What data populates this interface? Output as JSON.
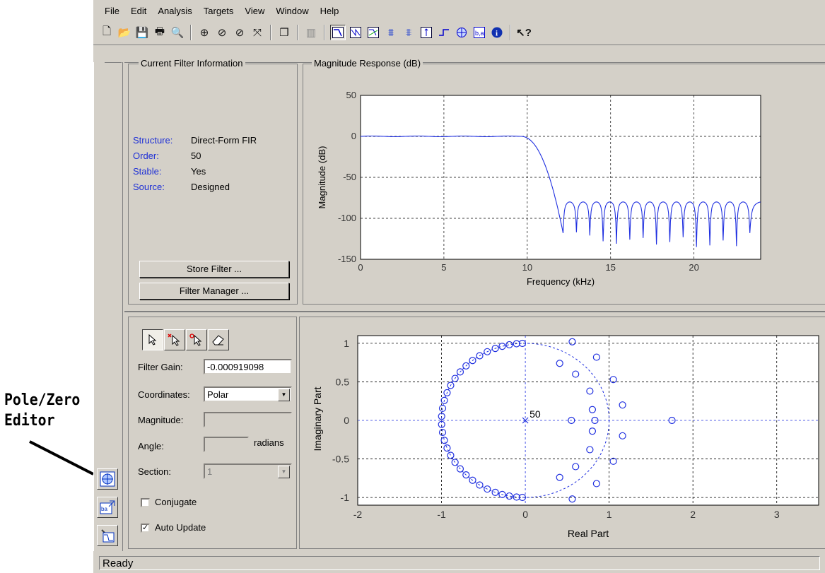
{
  "menu": [
    "File",
    "Edit",
    "Analysis",
    "Targets",
    "View",
    "Window",
    "Help"
  ],
  "toolbar_icons": [
    "new-icon",
    "open-icon",
    "save-icon",
    "print-icon",
    "print-preview-icon",
    "zoom-in-icon",
    "zoom-x-icon",
    "zoom-y-icon",
    "full-view-icon",
    "new-figure-icon",
    "data-tips-icon",
    "magnitude-response-icon",
    "phase-response-icon",
    "magnitude-phase-icon",
    "group-delay-icon",
    "phase-delay-icon",
    "impulse-response-icon",
    "step-response-icon",
    "pole-zero-plot-icon",
    "filter-coefficients-icon",
    "filter-information-icon",
    "whats-this-icon"
  ],
  "info_panel": {
    "title": "Current Filter Information",
    "rows": [
      {
        "key": "Structure:",
        "value": "Direct-Form FIR"
      },
      {
        "key": "Order:",
        "value": "50"
      },
      {
        "key": "Stable:",
        "value": "Yes"
      },
      {
        "key": "Source:",
        "value": "Designed"
      }
    ],
    "store_button": "Store Filter ...",
    "manager_button": "Filter Manager ..."
  },
  "mag_panel": {
    "title": "Magnitude Response (dB)"
  },
  "chart_data": [
    {
      "type": "line",
      "title": "",
      "xlabel": "Frequency (kHz)",
      "ylabel": "Magnitude (dB)",
      "xlim": [
        0,
        24
      ],
      "ylim": [
        -150,
        50
      ],
      "xticks": [
        0,
        5,
        10,
        15,
        20
      ],
      "yticks": [
        50,
        0,
        -50,
        -100,
        -150
      ],
      "grid": true,
      "series": [
        {
          "passband_edge_khz": 9.6,
          "stopband_edge_khz": 12.0,
          "passband_db": 0,
          "sidelobe_peak_db": -80,
          "notches_khz": [
            12.15,
            12.95,
            13.75,
            14.55,
            15.35,
            16.15,
            16.95,
            17.75,
            18.55,
            19.35,
            20.15,
            20.95,
            21.75,
            22.55,
            23.35
          ],
          "notch_depth_db": [
            -118,
            -117,
            -121,
            -128,
            -131,
            -126,
            -124,
            -132,
            -129,
            -123,
            -135,
            -133,
            -127,
            -134,
            -118
          ]
        }
      ]
    },
    {
      "type": "scatter",
      "title": "",
      "xlabel": "Real Part",
      "ylabel": "Imaginary Part",
      "xlim": [
        -2,
        3.5
      ],
      "ylim": [
        -1.1,
        1.1
      ],
      "xticks": [
        -2,
        -1,
        0,
        1,
        2,
        3
      ],
      "yticks": [
        1,
        0.5,
        0,
        -0.5,
        -1
      ],
      "grid": true,
      "pole_annotation": "50",
      "poles": [
        [
          0,
          0
        ]
      ],
      "zeros_unit_circle_deg": [
        92,
        96,
        101,
        106,
        111,
        117,
        123,
        129,
        135,
        141,
        147,
        153,
        159,
        165,
        171,
        177,
        183,
        189,
        195,
        201,
        207,
        213,
        219,
        225,
        231,
        237,
        243,
        249,
        254,
        259,
        264,
        268
      ],
      "zeros": [
        [
          0.56,
          1.02
        ],
        [
          0.85,
          0.82
        ],
        [
          0.41,
          0.74
        ],
        [
          0.6,
          0.6
        ],
        [
          1.05,
          0.53
        ],
        [
          0.77,
          0.38
        ],
        [
          1.16,
          0.2
        ],
        [
          0.8,
          0.14
        ],
        [
          0.55,
          0
        ],
        [
          0.83,
          0
        ],
        [
          1.75,
          0
        ],
        [
          0.56,
          -1.02
        ],
        [
          0.85,
          -0.82
        ],
        [
          0.41,
          -0.74
        ],
        [
          0.6,
          -0.6
        ],
        [
          1.05,
          -0.53
        ],
        [
          0.77,
          -0.38
        ],
        [
          1.16,
          -0.2
        ],
        [
          0.8,
          -0.14
        ]
      ]
    }
  ],
  "pz_editor": {
    "filter_gain_label": "Filter Gain:",
    "filter_gain_value": "-0.000919098",
    "coordinates_label": "Coordinates:",
    "coordinates_value": "Polar",
    "magnitude_label": "Magnitude:",
    "angle_label": "Angle:",
    "angle_units": "radians",
    "section_label": "Section:",
    "section_value": "1",
    "conjugate_label": "Conjugate",
    "conjugate_checked": false,
    "auto_update_label": "Auto Update",
    "auto_update_checked": true
  },
  "side_buttons": [
    "pole-zero-editor-icon",
    "import-filter-icon",
    "filter-design-icon"
  ],
  "callout": {
    "line1": "Pole/Zero",
    "line2": "Editor"
  },
  "status": "Ready"
}
